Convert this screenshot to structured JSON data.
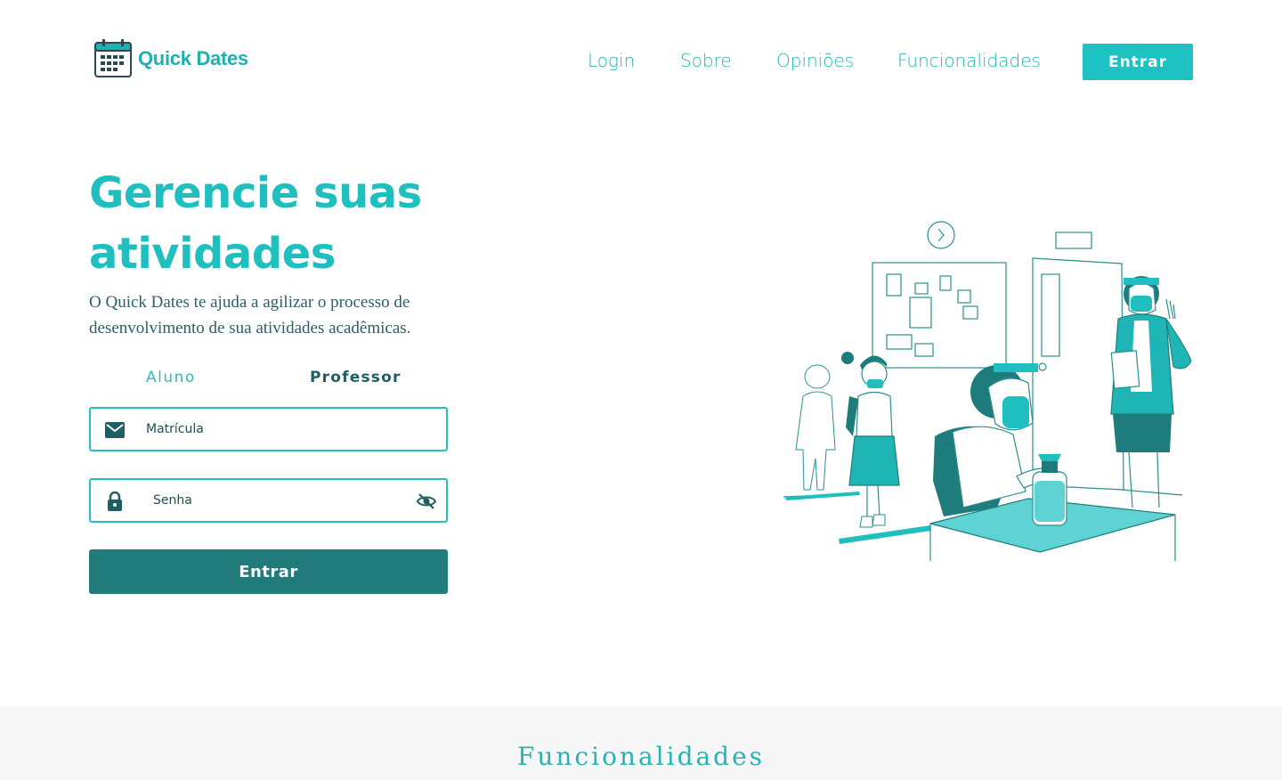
{
  "brand": {
    "name": "Quick Dates",
    "icon": "calendar-icon"
  },
  "nav": {
    "items": [
      {
        "label": "Login"
      },
      {
        "label": "Sobre"
      },
      {
        "label": "Opiniões"
      },
      {
        "label": "Funcionalidades"
      }
    ],
    "cta_label": "Entrar"
  },
  "hero": {
    "title": "Gerencie suas atividades",
    "subtitle": "O Quick Dates te ajuda a agilizar o processo de desenvolvimento de sua atividades acadêmicas."
  },
  "login": {
    "tabs": [
      {
        "label": "Aluno"
      },
      {
        "label": "Professor"
      }
    ],
    "matricula_placeholder": "Matrícula",
    "senha_placeholder": "Senha",
    "submit_label": "Entrar",
    "icons": {
      "matricula": "envelope-icon",
      "senha": "lock-icon",
      "toggle": "eye-off-icon"
    }
  },
  "features": {
    "title": "Funcionalidades"
  },
  "colors": {
    "accent": "#1fbfbf",
    "dark": "#227b7b",
    "text": "#2c5f66",
    "section_bg": "#f7f7f7"
  }
}
